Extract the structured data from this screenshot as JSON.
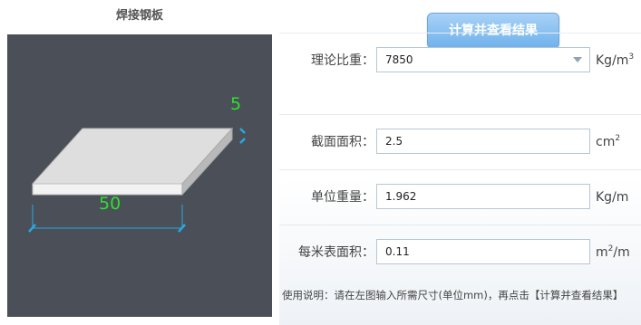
{
  "panel": {
    "title": "焊接钢板",
    "dimensions": {
      "width_label": "50",
      "thickness_label": "5"
    }
  },
  "calc_button_label": "计算并查看结果",
  "fields": {
    "density": {
      "label": "理论比重：",
      "value": "7850",
      "unit_base": "Kg/m",
      "unit_sup": "3"
    },
    "area": {
      "label": "截面面积：",
      "value": "2.5",
      "unit_base": "cm",
      "unit_sup": "2"
    },
    "unit_weight": {
      "label": "单位重量：",
      "value": "1.962",
      "unit_base": "Kg/m",
      "unit_sup": ""
    },
    "surface_area": {
      "label": "每米表面积：",
      "value": "0.11",
      "unit_base": "m",
      "unit_sup": "2",
      "unit_tail": "/m"
    }
  },
  "usage_note": "使用说明：请在左图输入所需尺寸(单位mm)，再点击【计算并查看结果】",
  "colors": {
    "canvas_bg": "#4b4f58",
    "dimension_text": "#2ee02e",
    "dimension_marker": "#27a9e1",
    "button": "#6fb1ec"
  }
}
